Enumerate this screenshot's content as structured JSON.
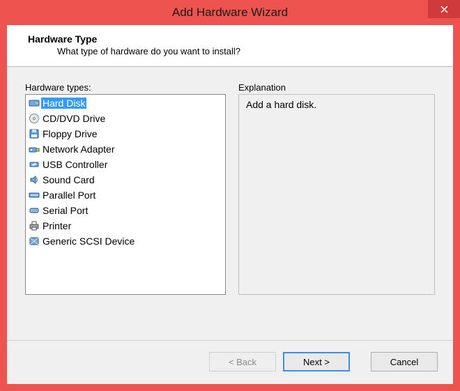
{
  "window": {
    "title": "Add Hardware Wizard"
  },
  "header": {
    "title": "Hardware Type",
    "subtitle": "What type of hardware do you want to install?"
  },
  "labels": {
    "hardware_types": "Hardware types:",
    "explanation": "Explanation"
  },
  "hardware_items": [
    {
      "label": "Hard Disk",
      "icon": "harddisk",
      "selected": true
    },
    {
      "label": "CD/DVD Drive",
      "icon": "cd",
      "selected": false
    },
    {
      "label": "Floppy Drive",
      "icon": "floppy",
      "selected": false
    },
    {
      "label": "Network Adapter",
      "icon": "network",
      "selected": false
    },
    {
      "label": "USB Controller",
      "icon": "usb",
      "selected": false
    },
    {
      "label": "Sound Card",
      "icon": "sound",
      "selected": false
    },
    {
      "label": "Parallel Port",
      "icon": "parallel",
      "selected": false
    },
    {
      "label": "Serial Port",
      "icon": "serial",
      "selected": false
    },
    {
      "label": "Printer",
      "icon": "printer",
      "selected": false
    },
    {
      "label": "Generic SCSI Device",
      "icon": "scsi",
      "selected": false
    }
  ],
  "explanation_text": "Add a hard disk.",
  "buttons": {
    "back": "< Back",
    "next": "Next >",
    "cancel": "Cancel"
  }
}
